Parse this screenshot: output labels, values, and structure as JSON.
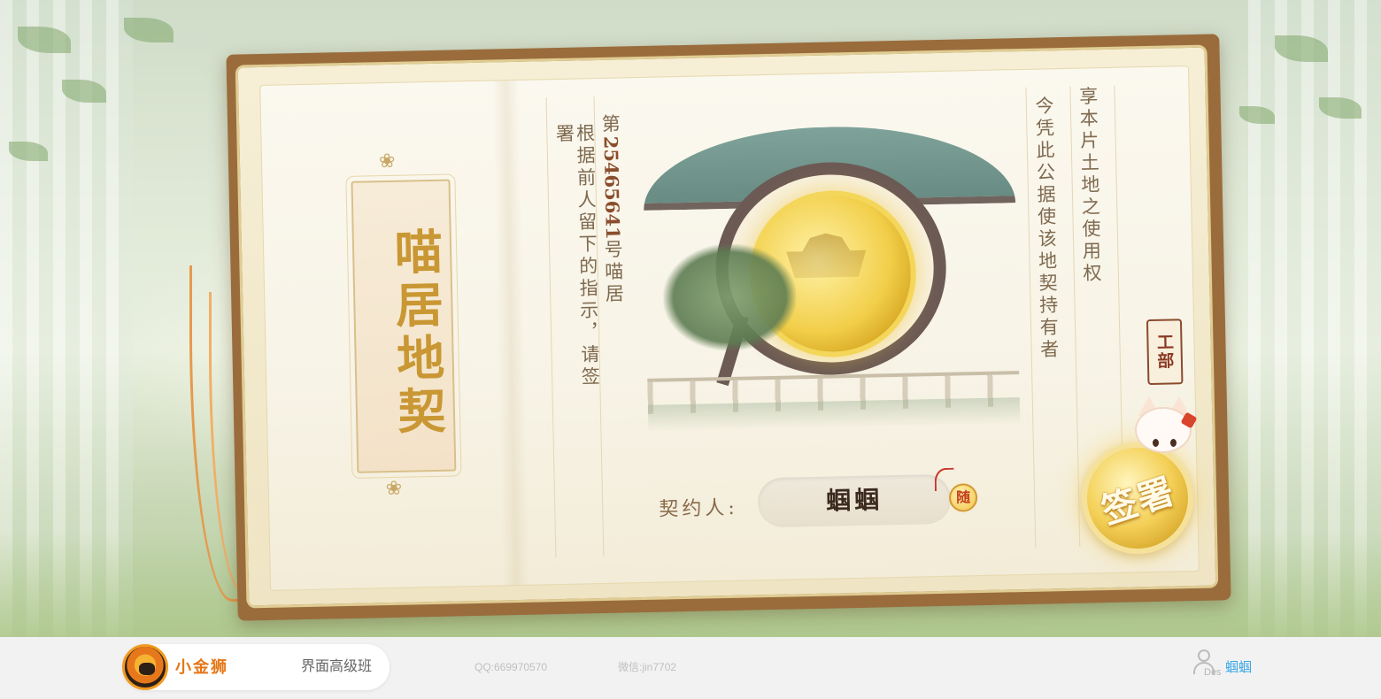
{
  "game": {
    "title": "喵居地契",
    "deed_number_prefix": "第",
    "deed_number": "25465641",
    "deed_number_suffix": "号喵居",
    "instruction": "根据前人留下的指示，请签署",
    "right_col_1": "享本片土地之使用权",
    "right_col_2": "今凭此公据使该地契持有者",
    "seal_text": "工部",
    "contract_label": "契约人:",
    "signer_name": "蝈蝈",
    "random_badge": "随",
    "sign_button": "签署"
  },
  "footer": {
    "brand_name": "小金狮",
    "course_name": "界面高级班",
    "qq": "QQ:669970570",
    "wechat": "微信:jin7702",
    "user_tag": "Des",
    "user_name": "蝈蝈"
  },
  "colors": {
    "title_gold": "#c99733",
    "brand_orange": "#e57616",
    "link_blue": "#3aa6e5"
  }
}
